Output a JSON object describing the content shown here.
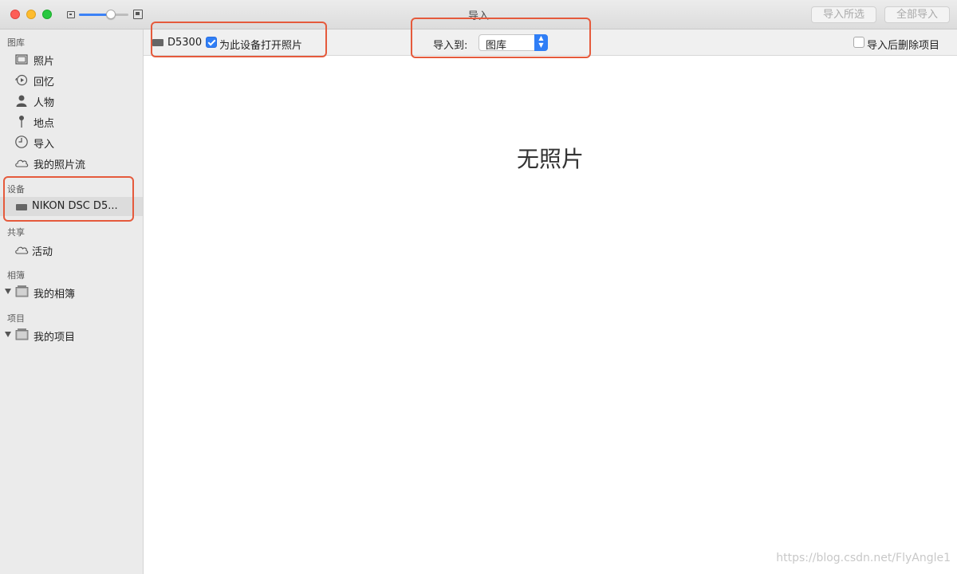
{
  "window": {
    "title": "导入"
  },
  "titlebar": {
    "import_selected": "导入所选",
    "import_all": "全部导入",
    "thumbnail_zoom_level": 0.65
  },
  "sidebar": {
    "library": {
      "header": "图库",
      "items": [
        {
          "label": "照片",
          "icon": "photos-icon"
        },
        {
          "label": "回忆",
          "icon": "memories-icon"
        },
        {
          "label": "人物",
          "icon": "people-icon"
        },
        {
          "label": "地点",
          "icon": "places-icon"
        },
        {
          "label": "导入",
          "icon": "imports-icon"
        },
        {
          "label": "我的照片流",
          "icon": "photo-stream-icon"
        }
      ]
    },
    "devices": {
      "header": "设备",
      "items": [
        {
          "label": "NIKON DSC D5...",
          "icon": "camera-icon",
          "selected": true
        }
      ]
    },
    "shared": {
      "header": "共享",
      "items": [
        {
          "label": "活动",
          "icon": "cloud-icon"
        }
      ]
    },
    "albums": {
      "header": "相簿",
      "items": [
        {
          "label": "我的相簿",
          "icon": "folder-icon",
          "expanded": true
        }
      ]
    },
    "projects": {
      "header": "项目",
      "items": [
        {
          "label": "我的项目",
          "icon": "folder-icon",
          "expanded": true
        }
      ]
    }
  },
  "toolbar": {
    "device_name": "D5300",
    "open_photos_label": "为此设备打开照片",
    "open_photos_checked": true,
    "import_to_label": "导入到:",
    "import_to_value": "图库",
    "delete_after_label": "导入后删除项目",
    "delete_after_checked": false
  },
  "main": {
    "empty_message": "无照片"
  },
  "watermark": "https://blog.csdn.net/FlyAngle1",
  "colors": {
    "annotation": "#e55a3c",
    "accent": "#2f7ef6"
  }
}
